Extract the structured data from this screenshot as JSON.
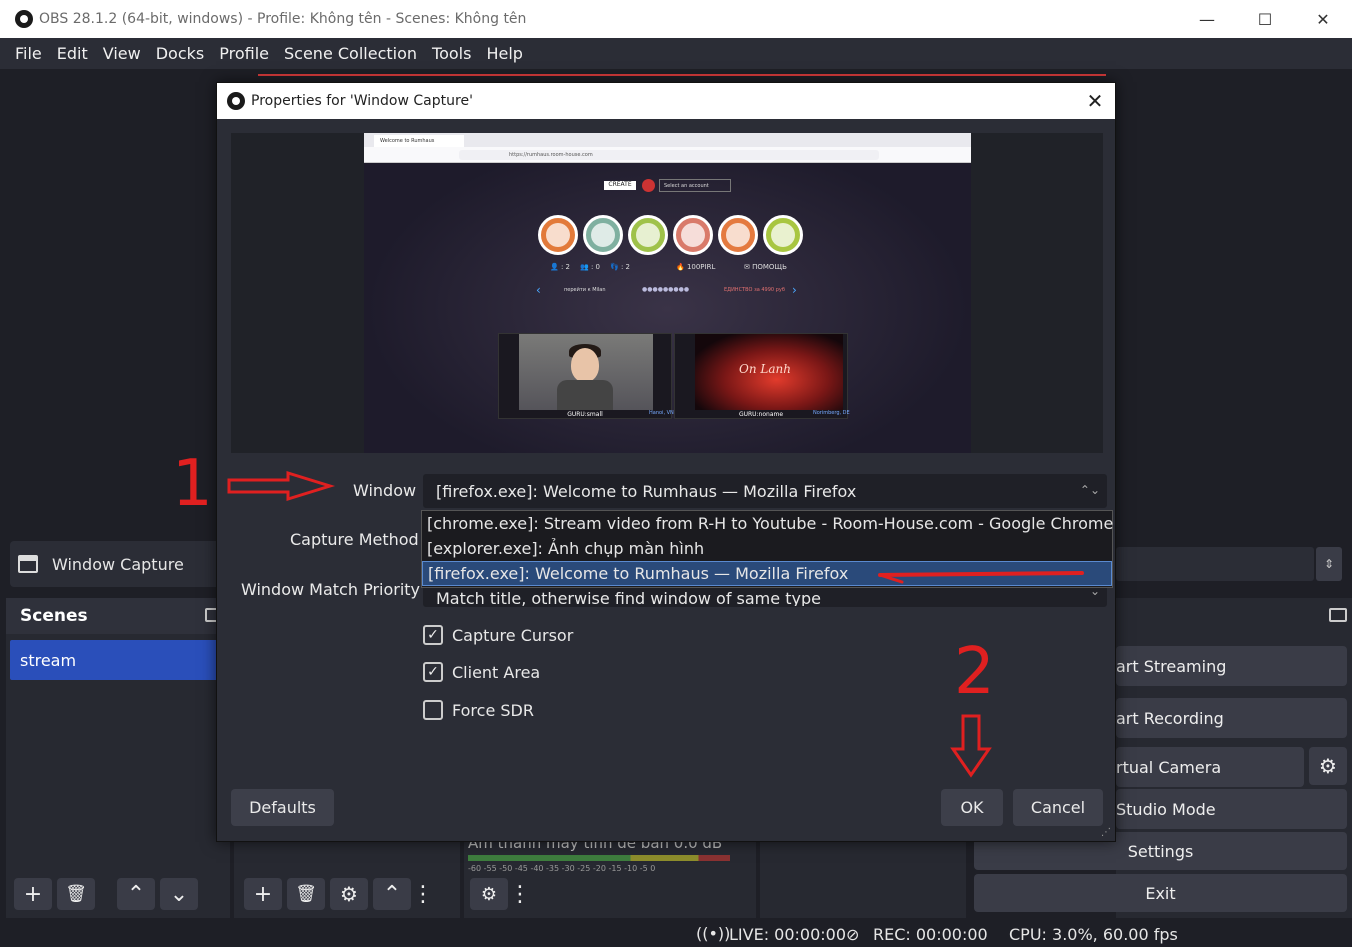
{
  "window": {
    "title": "OBS 28.1.2 (64-bit, windows) - Profile: Không tên - Scenes: Không tên",
    "minimize": "—",
    "maximize": "☐",
    "close": "✕"
  },
  "menu": [
    "File",
    "Edit",
    "View",
    "Docks",
    "Profile",
    "Scene Collection",
    "Tools",
    "Help"
  ],
  "source_bar": {
    "label": "Window Capture"
  },
  "scenes": {
    "title": "Scenes",
    "items": [
      "stream"
    ]
  },
  "controls": {
    "start_streaming": "art Streaming",
    "start_recording": "art Recording",
    "virtual_camera": "rtual Camera",
    "studio_mode": "Studio Mode",
    "settings": "Settings",
    "exit": "Exit"
  },
  "mixer": {
    "label": "Âm thanh máy tính để bàn  0.0 dB",
    "ticks": "-60 -55 -50 -45 -40 -35 -30 -25 -20 -15 -10 -5 0"
  },
  "status": {
    "live": "LIVE: 00:00:00",
    "rec": "REC: 00:00:00",
    "cpu": "CPU: 3.0%, 60.00 fps"
  },
  "dialog": {
    "title": "Properties for 'Window Capture'",
    "close": "✕",
    "preview": {
      "tab": "Welcome to Rumhaus",
      "url": "https://rumhaus.room-house.com",
      "create": "CREATE",
      "account": "Select an account",
      "stats": [
        "👤 : 2",
        "👥 : 0",
        "👣 : 2",
        "🔥 100PIRL",
        "✉ ПОМОЩЬ"
      ],
      "nav_text": "перейти к   Milan",
      "dots": "●●●●●●●●●",
      "nav_right": "ЕДИНСТВО   за 4990 руб",
      "cam1_label": "GURU:small",
      "cam1_loc": "Hanoi, VN",
      "cam2_label": "GURU:noname",
      "cam2_loc": "Norimberg, DE",
      "cam2_script": "On Lanh"
    },
    "window_label": "Window",
    "window_value": "[firefox.exe]: Welcome to Rumhaus — Mozilla Firefox",
    "capture_method_label": "Capture Method",
    "match_priority_label": "Window Match Priority",
    "match_priority_value": "Match title, otherwise find window of same type",
    "dropdown_options": [
      "[chrome.exe]: Stream video from R-H to Youtube - Room-House.com - Google Chrome",
      "[explorer.exe]: Ảnh chụp màn hình",
      "[firefox.exe]: Welcome to Rumhaus — Mozilla Firefox"
    ],
    "capture_cursor": "Capture Cursor",
    "capture_cursor_checked": true,
    "client_area": "Client Area",
    "client_area_checked": true,
    "force_sdr": "Force SDR",
    "force_sdr_checked": false,
    "defaults": "Defaults",
    "ok": "OK",
    "cancel": "Cancel"
  },
  "annotations": {
    "step1": "1",
    "step2": "2",
    "color": "#e02020"
  }
}
